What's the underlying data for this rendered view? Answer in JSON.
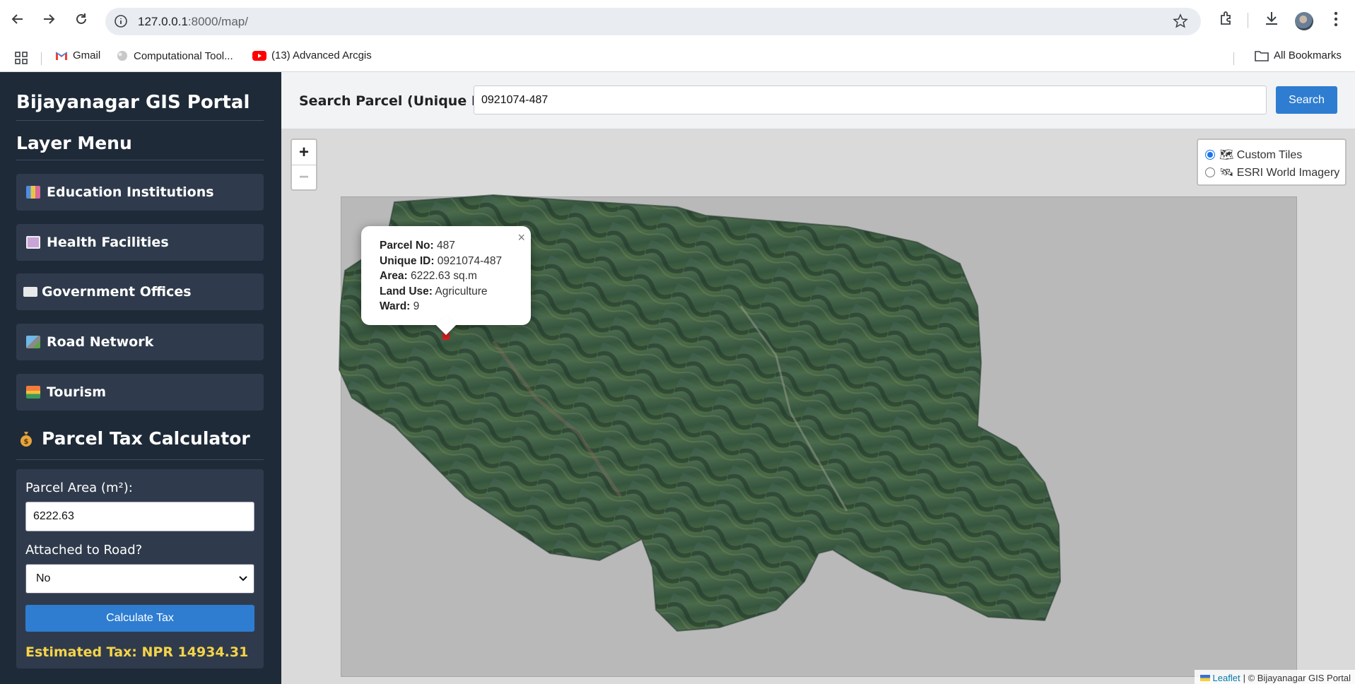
{
  "browser": {
    "url_host": "127.0.0.1",
    "url_rest": ":8000/map/",
    "bookmarks": [
      {
        "label": "Gmail"
      },
      {
        "label": "Computational Tool..."
      },
      {
        "label": "(13) Advanced Arcgis"
      }
    ],
    "all_bookmarks": "All Bookmarks"
  },
  "sidebar": {
    "title": "Bijayanagar GIS Portal",
    "layer_menu_title": "Layer Menu",
    "layers": [
      {
        "label": "Education Institutions",
        "icon": "books-icon"
      },
      {
        "label": "Health Facilities",
        "icon": "hospital-icon"
      },
      {
        "label": "Government Offices",
        "icon": "office-icon"
      },
      {
        "label": "Road Network",
        "icon": "road-icon"
      },
      {
        "label": "Tourism",
        "icon": "sunrise-icon"
      }
    ],
    "calculator": {
      "title": "Parcel Tax Calculator",
      "icon": "money-bag-icon",
      "area_label": "Parcel Area (m²):",
      "area_value": "6222.63",
      "road_label": "Attached to Road?",
      "road_value": "No",
      "button_label": "Calculate Tax",
      "result": "Estimated Tax: NPR 14934.31"
    }
  },
  "search": {
    "label": "Search Parcel (Unique ID):",
    "value": "0921074-487",
    "button_label": "Search"
  },
  "map": {
    "zoom_in": "+",
    "zoom_out": "−",
    "base_layers": [
      {
        "label": "🗺 Custom Tiles",
        "selected": true
      },
      {
        "label": "🛰 ESRI World Imagery",
        "selected": false
      }
    ],
    "popup": {
      "close": "×",
      "rows": [
        {
          "key": "Parcel No:",
          "value": " 487"
        },
        {
          "key": "Unique ID:",
          "value": " 0921074-487"
        },
        {
          "key": "Area:",
          "value": " 6222.63 sq.m"
        },
        {
          "key": "Land Use:",
          "value": " Agriculture"
        },
        {
          "key": "Ward:",
          "value": " 9"
        }
      ]
    },
    "attribution": {
      "leaflet": "Leaflet",
      "rest": "| © Bijayanagar GIS Portal"
    }
  },
  "colors": {
    "sidebar_bg": "#1f2a38",
    "panel_bg": "#2f3b4c",
    "accent_blue": "#2e7dd1",
    "tax_yellow": "#f6d34a"
  }
}
